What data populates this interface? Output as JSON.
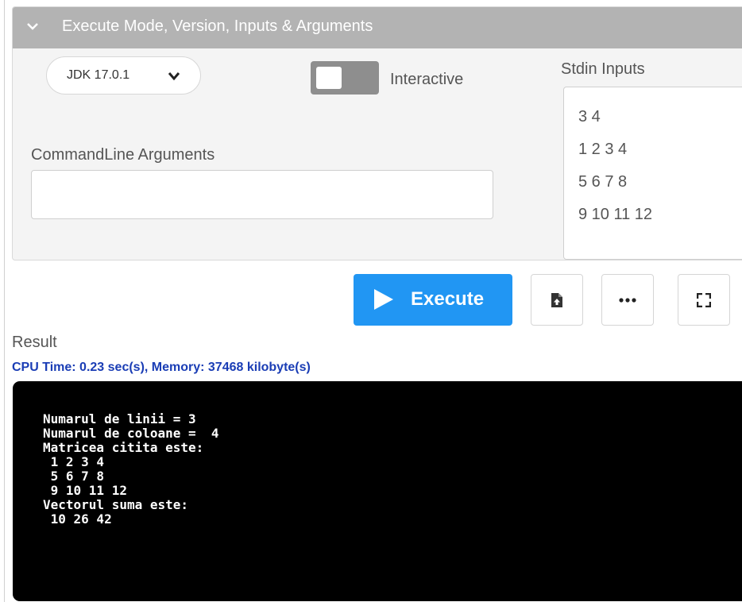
{
  "header": {
    "title": "Execute Mode, Version, Inputs & Arguments"
  },
  "jdk_select": {
    "value": "JDK 17.0.1"
  },
  "interactive": {
    "label": "Interactive"
  },
  "stdin": {
    "title": "Stdin Inputs",
    "lines": [
      "3 4",
      "1 2 3 4",
      "5 6 7 8",
      "9 10 11 12"
    ]
  },
  "cmdline": {
    "title": "CommandLine Arguments",
    "value": ""
  },
  "toolbar": {
    "execute_label": "Execute"
  },
  "result": {
    "label": "Result",
    "cpu_line": "CPU Time: 0.23 sec(s), Memory: 37468 kilobyte(s)",
    "output_lines": [
      "Numarul de linii = 3",
      "Numarul de coloane =  4",
      "Matricea citita este:",
      " 1 2 3 4",
      " 5 6 7 8",
      " 9 10 11 12",
      "Vectorul suma este:",
      " 10 26 42"
    ]
  },
  "icons": [
    "chevron-down-icon",
    "play-icon",
    "file-upload-icon",
    "more-icon",
    "fullscreen-icon"
  ]
}
